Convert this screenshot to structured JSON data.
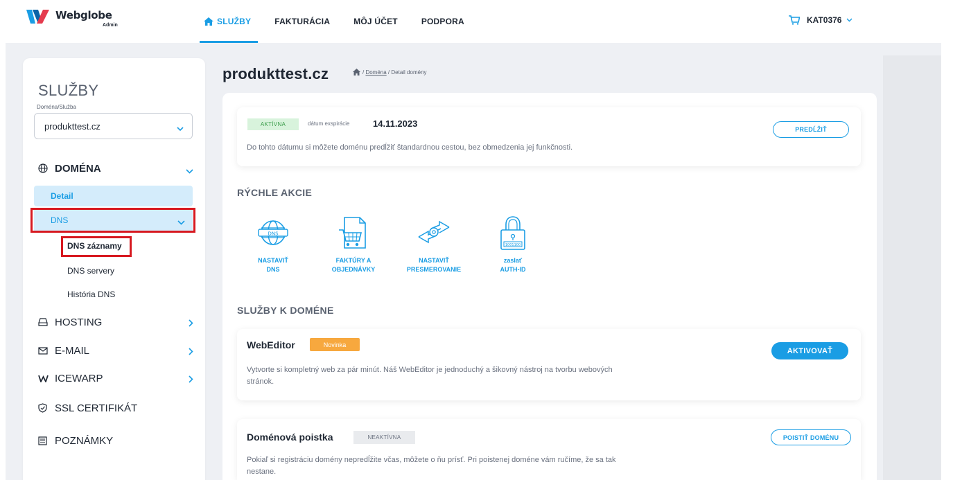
{
  "brand": {
    "name": "Webglobe",
    "sub": "Admin",
    "color": "#1a9de4"
  },
  "nav": {
    "items": [
      {
        "label": "SLUŽBY",
        "active": true,
        "icon": "home-icon"
      },
      {
        "label": "FAKTURÁCIA",
        "active": false
      },
      {
        "label": "MÔJ ÚČET",
        "active": false
      },
      {
        "label": "PODPORA",
        "active": false
      }
    ],
    "account": {
      "code": "KAT0376",
      "icon": "cart-icon"
    }
  },
  "sidebar": {
    "title": "SLUŽBY",
    "select_label": "Doména/Služba",
    "select_value": "produkttest.cz",
    "groups": [
      {
        "label": "DOMÉNA",
        "icon": "globe-icon",
        "expanded": true
      },
      {
        "label": "HOSTING",
        "icon": "server-icon"
      },
      {
        "label": "E-MAIL",
        "icon": "mail-icon"
      },
      {
        "label": "ICEWARP",
        "icon": "icewarp-icon"
      },
      {
        "label": "SSL CERTIFIKÁT",
        "icon": "shield-icon"
      },
      {
        "label": "POZNÁMKY",
        "icon": "notes-icon"
      }
    ],
    "domain_items": {
      "detail": "Detail",
      "dns": "DNS"
    },
    "dns_subitems": [
      "DNS záznamy",
      "DNS servery",
      "História DNS"
    ]
  },
  "main": {
    "title": "produkttest.cz",
    "breadcrumb": {
      "link": "Doména",
      "current": "Detail domény"
    },
    "status": {
      "badge": "AKTÍVNA",
      "exp_label": "dátum exspirácie",
      "exp_date": "14.11.2023",
      "description": "Do tohto dátumu si môžete doménu predĺžiť štandardnou cestou, bez obmedzenia jej funkčnosti.",
      "button": "PREDĹŽIŤ"
    },
    "quick_actions": {
      "heading": "RÝCHLE AKCIE",
      "items": [
        {
          "line1": "NASTAVIŤ",
          "line2": "DNS",
          "icon": "dns-globe-icon"
        },
        {
          "line1": "FAKTÚRY A",
          "line2": "OBJEDNÁVKY",
          "icon": "invoice-cart-icon"
        },
        {
          "line1": "NASTAVIŤ",
          "line2": "PRESMEROVANIE",
          "icon": "redirect-gear-icon"
        },
        {
          "line1": "zaslať",
          "line2": "AUTH-ID",
          "icon": "padlock-icon"
        }
      ]
    },
    "services": {
      "heading": "SLUŽBY K DOMÉNE",
      "webeditor": {
        "title": "WebEditor",
        "badge": "Novinka",
        "desc_line1": "Vytvorte si kompletný web za pár minút. Náš WebEditor je jednoduchý a šikovný nástroj na tvorbu webových",
        "desc_line2": "stránok.",
        "button": "AKTIVOVAŤ"
      },
      "insurance": {
        "title": "Doménová poistka",
        "badge": "NEAKTÍVNA",
        "desc_line1": "Pokiaľ si registráciu domény nepredĺžite včas, môžete o ňu prísť. Pri poistenej doméne vám ručíme, že sa tak",
        "desc_line2": "nestane.",
        "button": "POISTIŤ DOMÉNU"
      }
    }
  }
}
